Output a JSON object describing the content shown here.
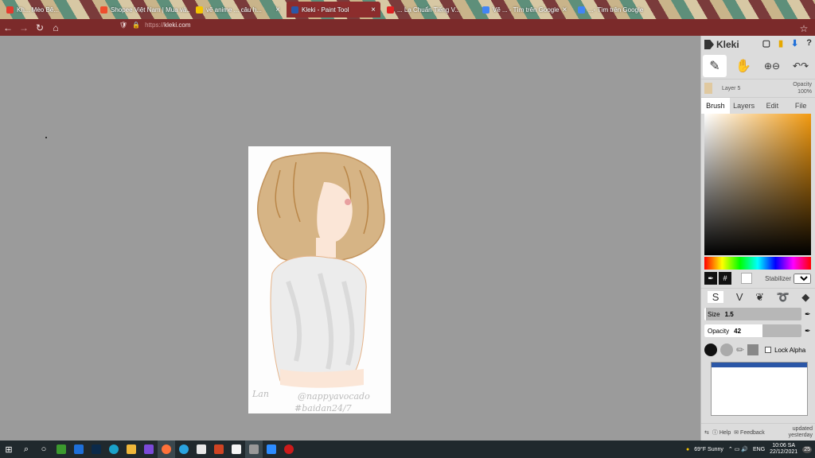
{
  "browser": {
    "tabs": [
      {
        "label": "Kh... Mèo Bê...",
        "favicon_color": "#e33b2e",
        "active": false
      },
      {
        "label": "Shopee Việt Nam | Mua và...",
        "favicon_color": "#ee4d2d",
        "active": false
      },
      {
        "label": "vẽ anime ... câu h...",
        "favicon_color": "#f5c400",
        "active": false
      },
      {
        "label": "Kleki - Paint Tool",
        "favicon_color": "#2b57a7",
        "active": true
      },
      {
        "label": "... Lạ Chuẩn Tiếng V...",
        "favicon_color": "#d22",
        "active": false
      },
      {
        "label": "Vẽ ... - Tìm trên Google",
        "favicon_color": "#4285f4",
        "active": false
      },
      {
        "label": "...- Tìm trên Google",
        "favicon_color": "#4285f4",
        "active": false
      }
    ],
    "url_protocol": "https://",
    "url_host": "kleki.com"
  },
  "panel": {
    "app_name": "Kleki",
    "layer_name": "Layer 5",
    "opacity_label": "Opacity",
    "opacity_value": "100%",
    "tabs": [
      "Brush",
      "Layers",
      "Edit",
      "File"
    ],
    "stabilizer_label": "Stabilizer",
    "stabilizer_value": "1",
    "size_label": "Size",
    "size_value": "1.5",
    "size_fraction": 0.02,
    "brush_opacity_label": "Opacity",
    "brush_opacity_value": "42",
    "brush_opacity_fraction": 0.6,
    "lock_alpha_label": "Lock Alpha",
    "help_label": "Help",
    "feedback_label": "Feedback",
    "updated_label": "updated yesterday"
  },
  "taskbar": {
    "weather": "69°F Sunny",
    "language": "ENG",
    "time": "10:06 SA",
    "date": "22/12/2021",
    "notification_count": "25"
  },
  "colors": {
    "active_tab": "#8c2d2d",
    "navbar": "#7b2a2a",
    "canvas_bg": "#9b9b9b",
    "panel_bg": "#dcdcdc"
  }
}
